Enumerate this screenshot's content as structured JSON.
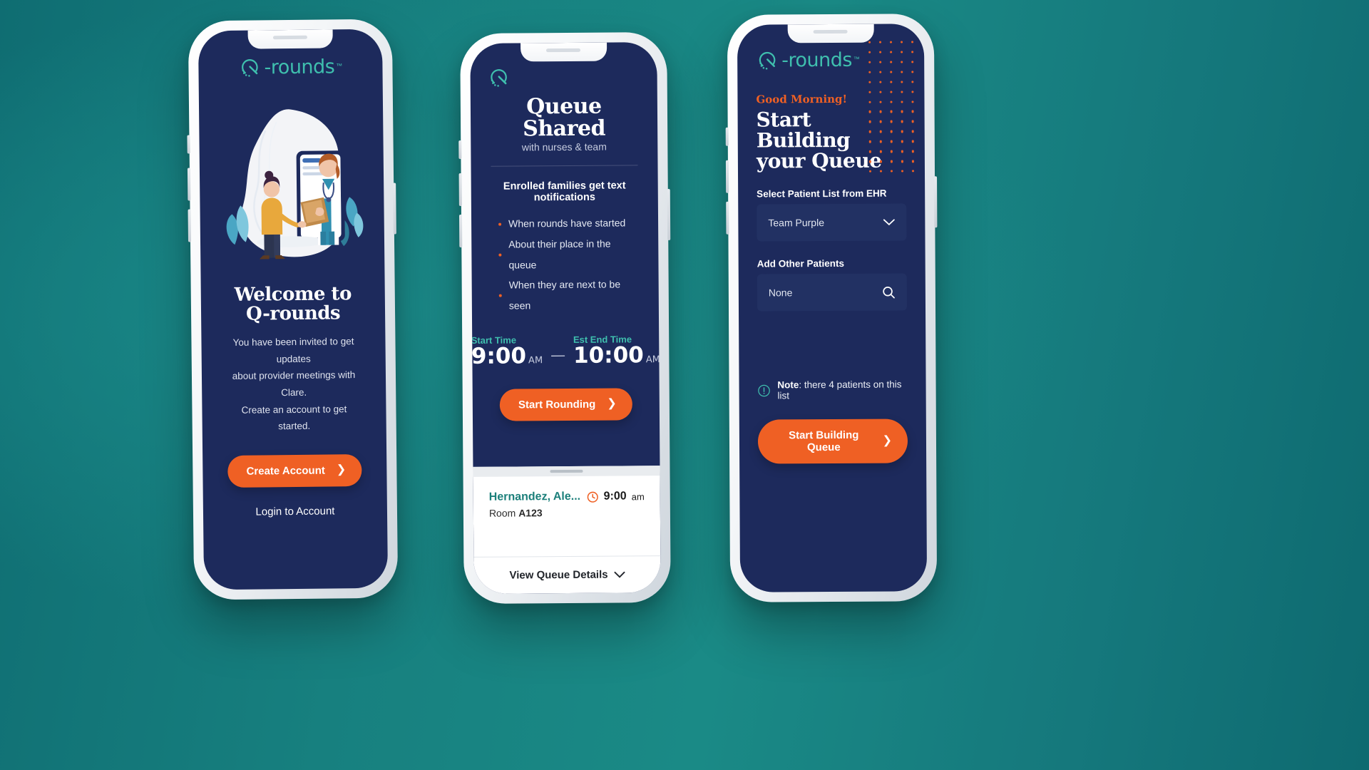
{
  "background": {
    "color": "#177f80"
  },
  "brand": {
    "name": "-rounds",
    "trademark": "™",
    "color": "#3fbfae",
    "mark_icon": "q-rounds-logo-icon"
  },
  "colors": {
    "navy": "#1d2a5c",
    "teal": "#3fbfae",
    "orange": "#ef6024",
    "teal_background": "#177f80"
  },
  "phone1": {
    "illustration_alt": "doctor-and-patient-illustration",
    "title": "Welcome to Q-rounds",
    "body_lines": [
      "You have been invited to get updates",
      "about provider meetings with Clare.",
      "Create an account to get started."
    ],
    "primary_button": "Create Account",
    "secondary_link": "Login to Account"
  },
  "phone2": {
    "title": "Queue Shared",
    "subtitle": "with nurses & team",
    "lead": "Enrolled families get text notifications",
    "bullets": [
      "When rounds have started",
      "About their place in the queue",
      "When they are next to be seen"
    ],
    "start_time": {
      "label": "Start Time",
      "value": "9:00",
      "suffix": "AM"
    },
    "end_time": {
      "label": "Est End Time",
      "value": "10:00",
      "suffix": "AM"
    },
    "dash": "—",
    "primary_button": "Start Rounding",
    "patient_card": {
      "name": "Hernandez, Ale...",
      "room_label": "Room",
      "room_value": "A123",
      "time": "9:00",
      "time_suffix": "am",
      "clock_icon": "clock-icon"
    },
    "footer_link": "View Queue Details"
  },
  "phone3": {
    "greeting": "Good Morning!",
    "title_line1": "Start Building",
    "title_line2": "your Queue",
    "fields": [
      {
        "label": "Select Patient List from EHR",
        "value": "Team Purple",
        "icon": "chevron-down-icon"
      },
      {
        "label": "Add Other Patients",
        "value": "None",
        "icon": "search-icon"
      }
    ],
    "note_prefix": "Note",
    "note_text": ": there 4 patients on this list",
    "note_icon": "info-exclamation-icon",
    "primary_button": "Start Building Queue"
  }
}
